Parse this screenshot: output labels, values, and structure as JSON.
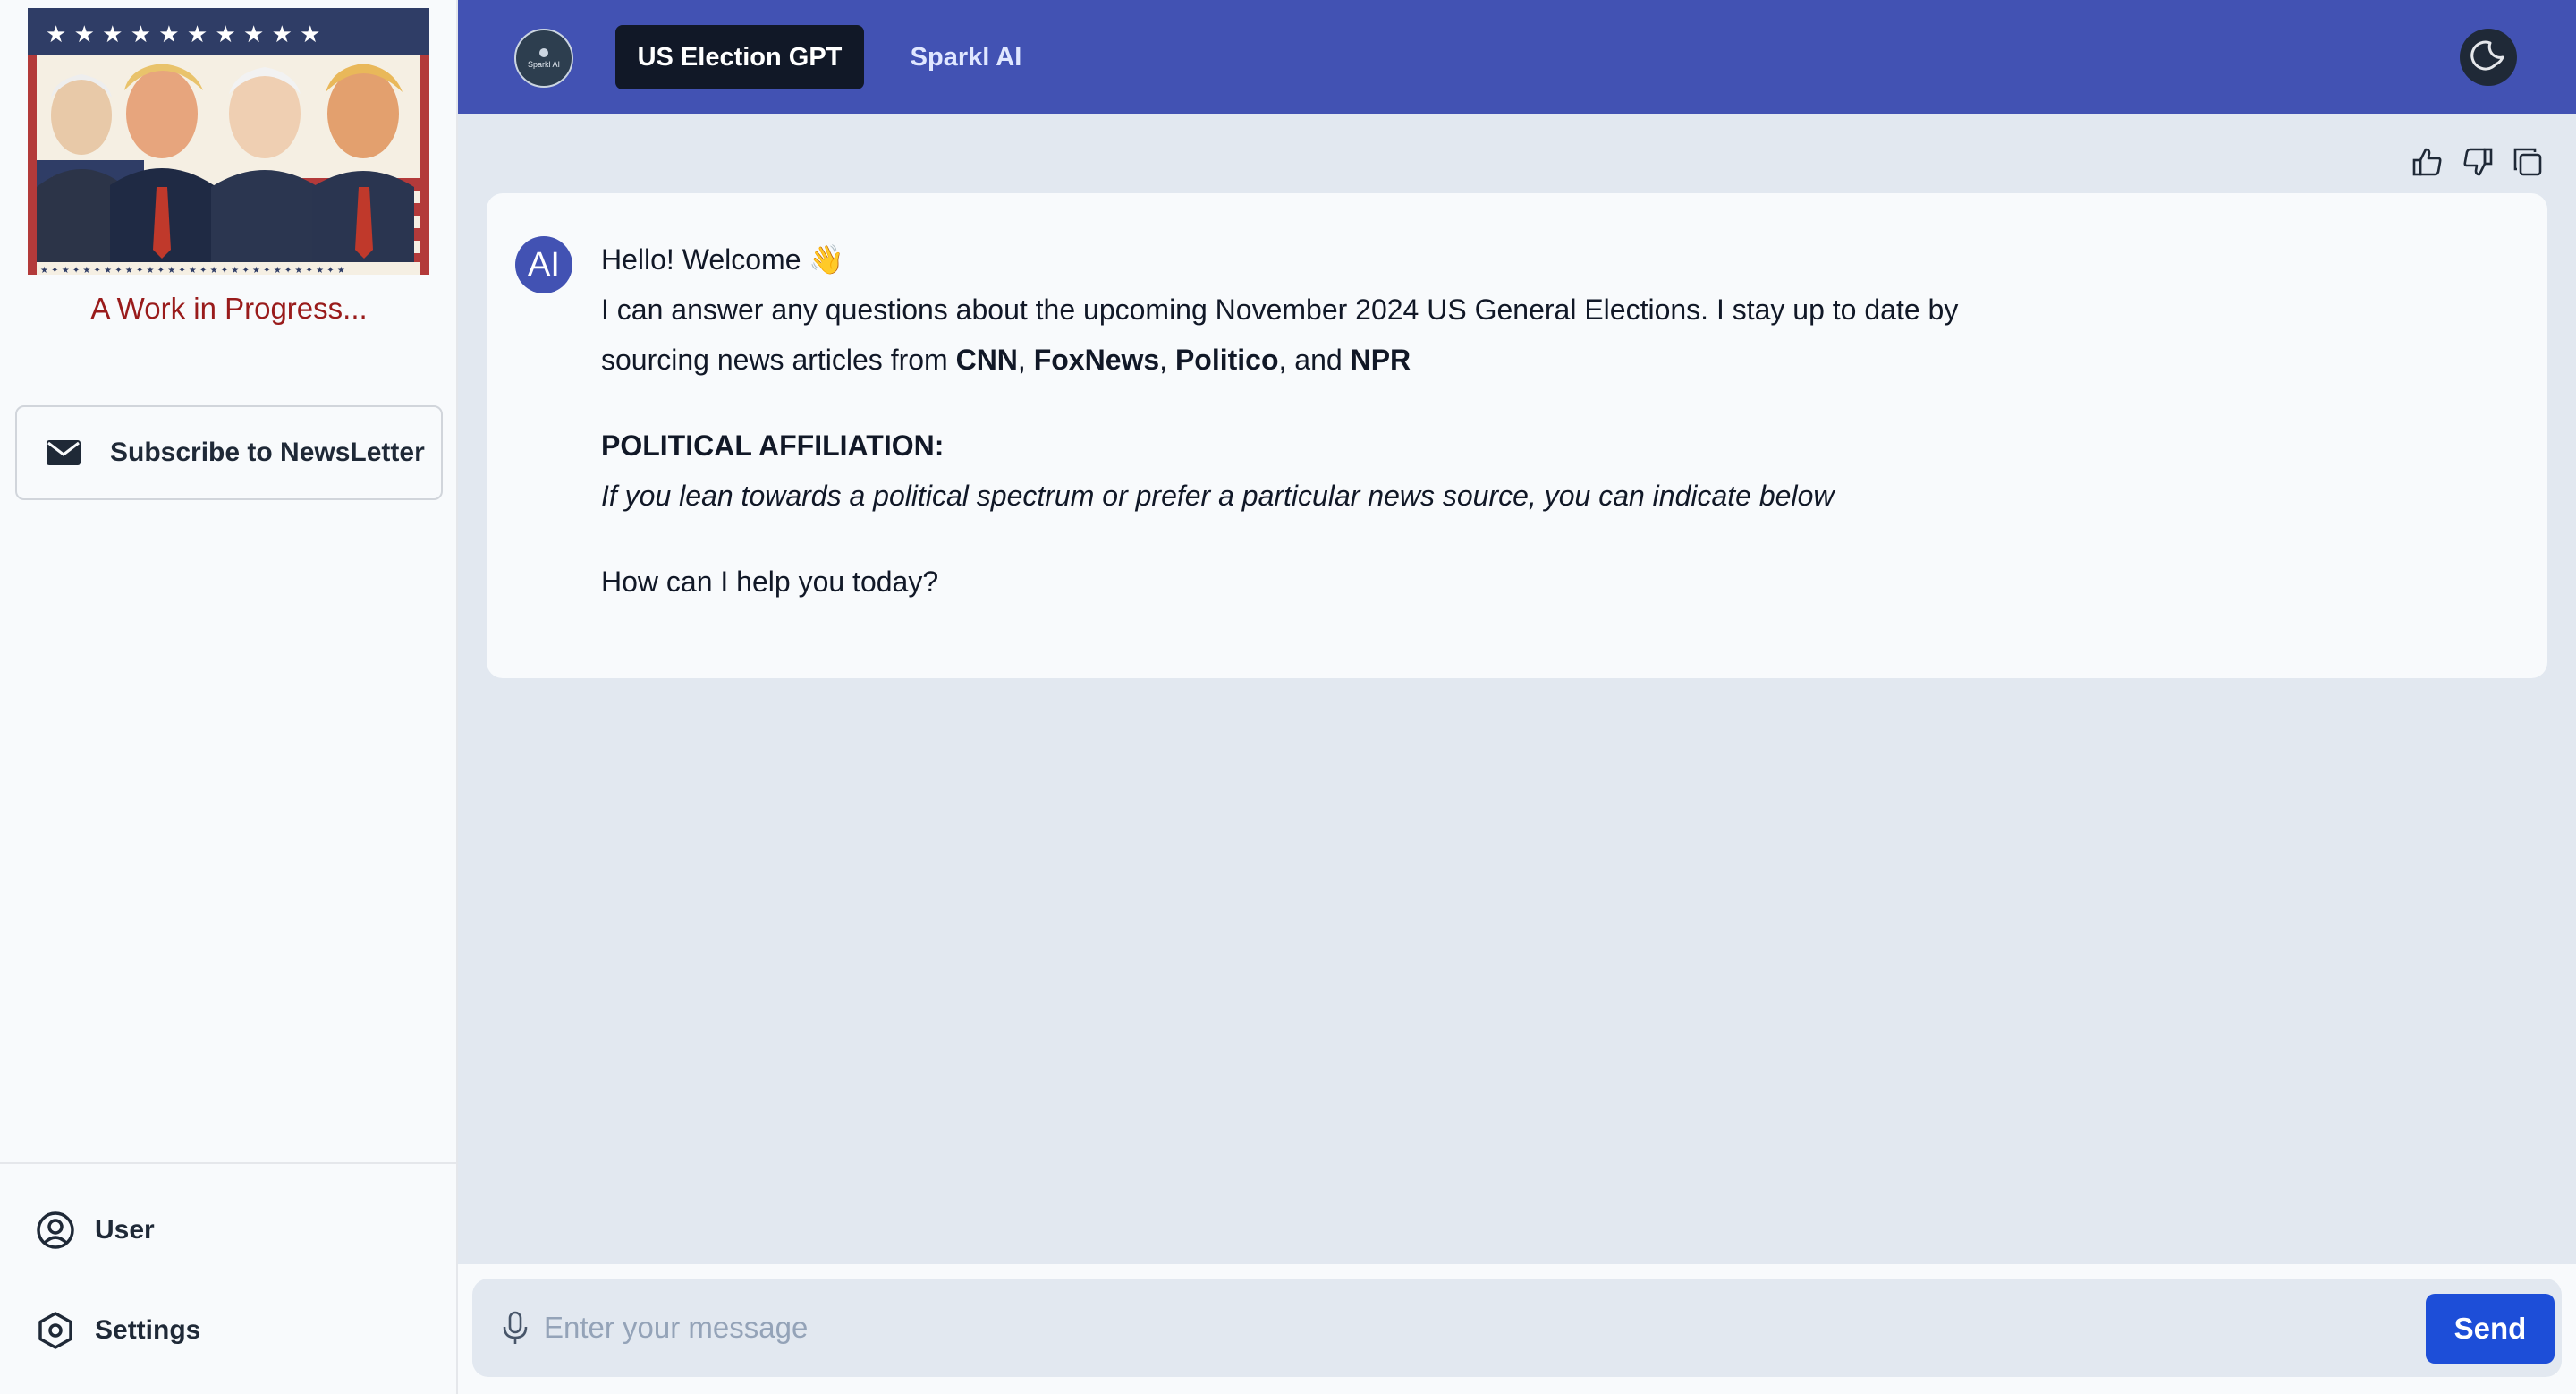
{
  "sidebar": {
    "tagline": "A Work in Progress...",
    "subscribe_label": "Subscribe to NewsLetter",
    "items": [
      {
        "label": "User",
        "icon": "user-circle-icon"
      },
      {
        "label": "Settings",
        "icon": "settings-hexagon-icon"
      }
    ],
    "banner_icon": "election-banner-image"
  },
  "header": {
    "logo_text": "Sparkl AI",
    "tabs": [
      {
        "label": "US Election GPT",
        "active": true
      },
      {
        "label": "Sparkl AI",
        "active": false
      }
    ],
    "theme_icon": "moon-icon"
  },
  "chat": {
    "feedback_icons": [
      "thumbs-up-icon",
      "thumbs-down-icon",
      "copy-icon"
    ],
    "message": {
      "avatar": "AI",
      "greeting": "Hello! Welcome",
      "wave": "👋",
      "intro": "I can answer any questions about the upcoming November 2024 US General Elections. I stay up to date by sourcing news articles from",
      "sources": [
        "CNN",
        "FoxNews",
        "Politico",
        "NPR"
      ],
      "sep1": ", ",
      "sep2": ", ",
      "sep3": ", and ",
      "affiliation_heading": "POLITICAL AFFILIATION:",
      "affiliation_text": "If you lean towards a political spectrum or prefer a particular news source, you can indicate below",
      "closing": "How can I help you today?"
    }
  },
  "input": {
    "placeholder": "Enter your message",
    "value": "",
    "send_label": "Send",
    "mic_icon": "microphone-icon"
  },
  "colors": {
    "header_bg": "#4252b3",
    "active_tab": "#111827",
    "send_button": "#1d4ed8",
    "tagline": "#991b1b",
    "chat_bg": "#e2e8f0"
  }
}
